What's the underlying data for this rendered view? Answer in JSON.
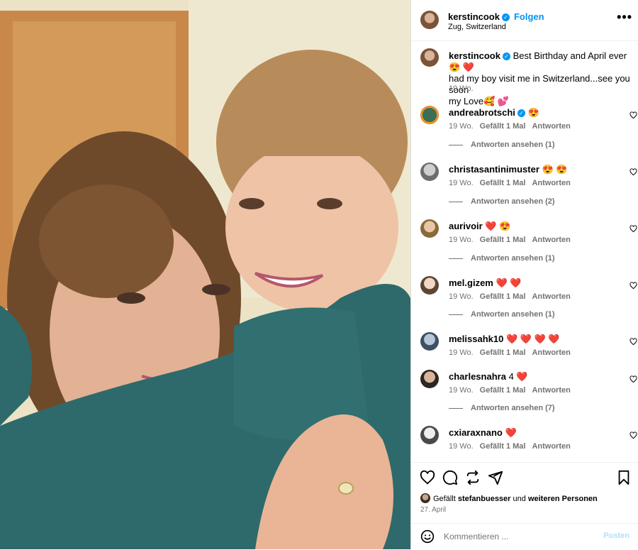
{
  "post": {
    "username": "kerstincook",
    "follow_label": "Folgen",
    "location": "Zug, Switzerland",
    "more_label": "•••"
  },
  "caption": {
    "username": "kerstincook",
    "line1": "Best Birthday and April ever 😍 ❤️",
    "line2": "had my boy visit me in Switzerland...see you soon",
    "line3": "my Love🥰 💕",
    "time": "19 Wo."
  },
  "labels": {
    "likes_one": "Gefällt 1 Mal",
    "reply": "Antworten"
  },
  "comments": [
    {
      "user": "andreabrotschi",
      "text": "😍",
      "time": "19 Wo.",
      "likes": "Gefällt 1 Mal",
      "replies": "Antworten ansehen (1)"
    },
    {
      "user": "christasantinimuster",
      "text": "😍 😍",
      "time": "19 Wo.",
      "likes": "Gefällt 1 Mal",
      "replies": "Antworten ansehen (2)"
    },
    {
      "user": "aurivoir",
      "text": "❤️ 😍",
      "time": "19 Wo.",
      "likes": "Gefällt 1 Mal",
      "replies": "Antworten ansehen (1)"
    },
    {
      "user": "mel.gizem",
      "text": "❤️ ❤️",
      "time": "19 Wo.",
      "likes": "Gefällt 1 Mal",
      "replies": "Antworten ansehen (1)"
    },
    {
      "user": "melissahk10",
      "text": "❤️ ❤️ ❤️ ❤️",
      "time": "19 Wo.",
      "likes": "Gefällt 1 Mal",
      "replies": ""
    },
    {
      "user": "charlesnahra",
      "text": "4 ❤️",
      "time": "19 Wo.",
      "likes": "Gefällt 1 Mal",
      "replies": "Antworten ansehen (7)"
    },
    {
      "user": "cxiaraxnano",
      "text": "❤️",
      "time": "19 Wo.",
      "likes": "Gefällt 1 Mal",
      "replies": ""
    }
  ],
  "liked_by": {
    "prefix": "Gefällt",
    "user": "stefanbuesser",
    "middle": "und",
    "others": "weiteren Personen"
  },
  "date": "27. April",
  "composer": {
    "placeholder": "Kommentieren ...",
    "post_label": "Posten"
  },
  "colors": {
    "accent": "#0095f6",
    "heart": "#e0245e",
    "secondary_text": "#737373"
  },
  "icons": [
    "verified-badge-icon",
    "more-options-icon",
    "like-heart-icon",
    "comment-icon",
    "share-icon",
    "send-icon",
    "save-bookmark-icon",
    "emoji-icon"
  ]
}
